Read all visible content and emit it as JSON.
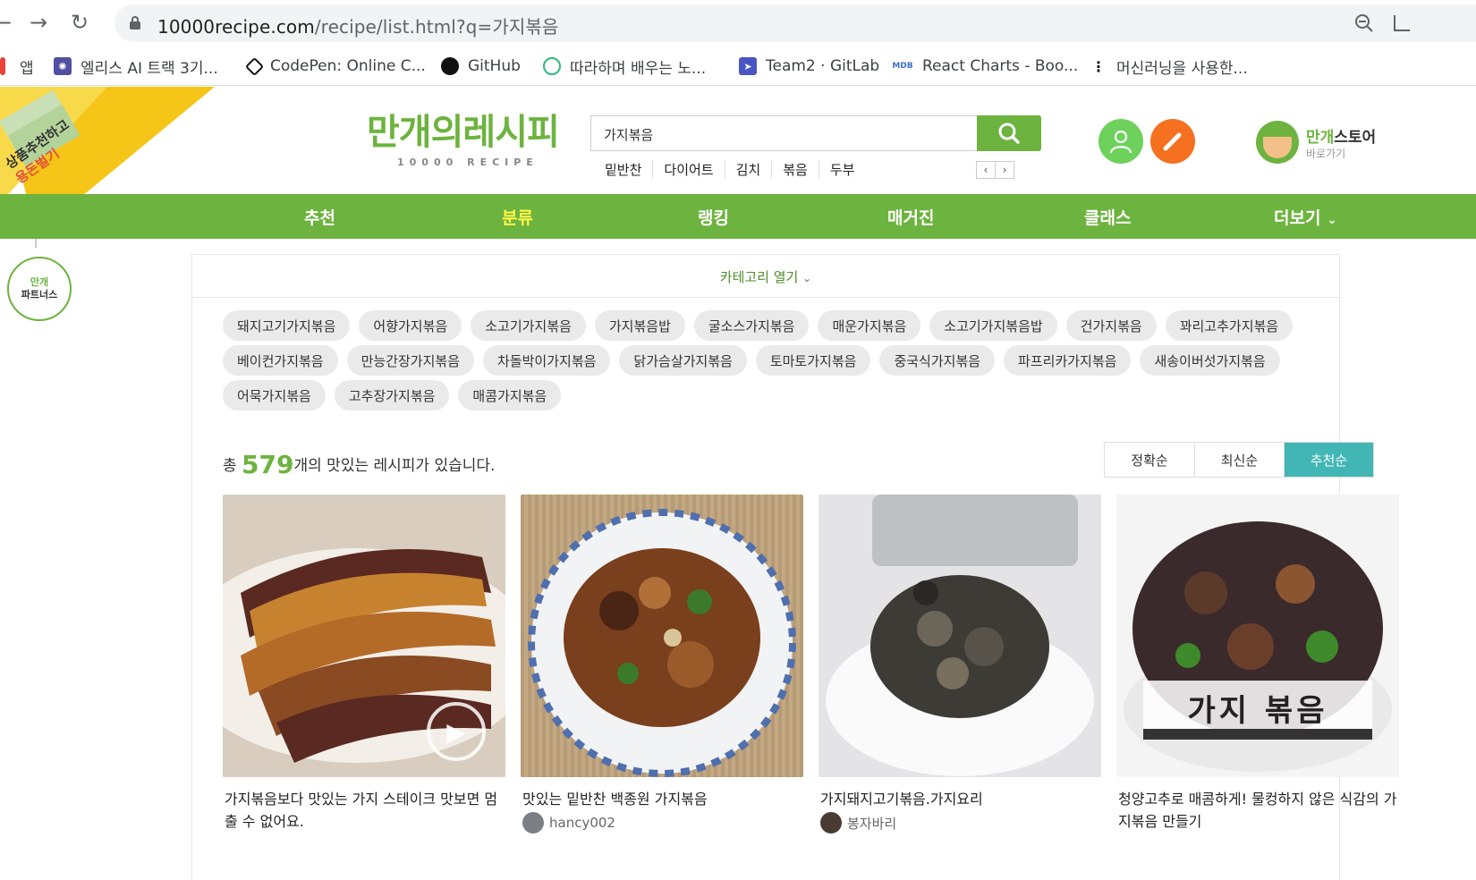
{
  "browser": {
    "url_host": "10000recipe.com",
    "url_rest": "/recipe/list.html?q=가지볶음",
    "bookmarks": [
      {
        "label": "앱",
        "icon": "apps-grid-icon"
      },
      {
        "label": "엘리스 AI 트랙 3기...",
        "icon": "elice-icon"
      },
      {
        "label": "CodePen: Online C...",
        "icon": "codepen-icon"
      },
      {
        "label": "GitHub",
        "icon": "github-icon"
      },
      {
        "label": "따라하며 배우는 노...",
        "icon": "tutorial-icon"
      },
      {
        "label": "Team2 · GitLab",
        "icon": "gitlab-icon"
      },
      {
        "label": "React Charts - Boo...",
        "icon": "mdb-icon"
      },
      {
        "label": "머신러닝을 사용한...",
        "icon": "dots-icon"
      }
    ]
  },
  "header": {
    "logo": "만개의레시피",
    "logo_sub": "10000 RECIPE",
    "search_value": "가지볶음",
    "keywords": [
      "밑반찬",
      "다이어트",
      "김치",
      "볶음",
      "두부"
    ],
    "store_title_a": "만개",
    "store_title_b": "스토어",
    "store_sub": "바로가기",
    "promo_line1": "상품추천하고",
    "promo_line2": "용돈벌기",
    "partners_top": "만개",
    "partners_bottom": "파트너스"
  },
  "nav": {
    "items": [
      "추천",
      "분류",
      "랭킹",
      "매거진",
      "클래스",
      "더보기"
    ],
    "active": "분류",
    "accent": "#6db33f"
  },
  "content": {
    "category_open": "카테고리 열기",
    "tags": [
      "돼지고기가지볶음",
      "어향가지볶음",
      "소고기가지볶음",
      "가지볶음밥",
      "굴소스가지볶음",
      "매운가지볶음",
      "소고기가지볶음밥",
      "건가지볶음",
      "꽈리고추가지볶음",
      "베이컨가지볶음",
      "만능간장가지볶음",
      "차돌박이가지볶음",
      "닭가슴살가지볶음",
      "토마토가지볶음",
      "중국식가지볶음",
      "파프리카가지볶음",
      "새송이버섯가지볶음",
      "어묵가지볶음",
      "고추장가지볶음",
      "매콤가지볶음"
    ],
    "total_prefix": "총",
    "total_count": "579",
    "total_suffix": "개의 맛있는 레시피가 있습니다.",
    "sort": [
      "정확순",
      "최신순",
      "추천순"
    ],
    "sort_active": "추천순",
    "sort_active_color": "#41b6b5"
  },
  "cards": [
    {
      "title": "가지볶음보다 맛있는 가지 스테이크 맛보면 멈출 수 없어요.",
      "author": "",
      "has_video": true
    },
    {
      "title": "맛있는 밑반찬 백종원 가지볶음",
      "author": "hancy002",
      "has_video": false
    },
    {
      "title": "가지돼지고기볶음.가지요리",
      "author": "봉자바리",
      "has_video": false
    },
    {
      "title": "청양고추로 매콤하게! 물컹하지 않은 식감의 가지볶음 만들기",
      "author": "",
      "has_video": false,
      "overlay_text": "가지 볶음"
    }
  ]
}
